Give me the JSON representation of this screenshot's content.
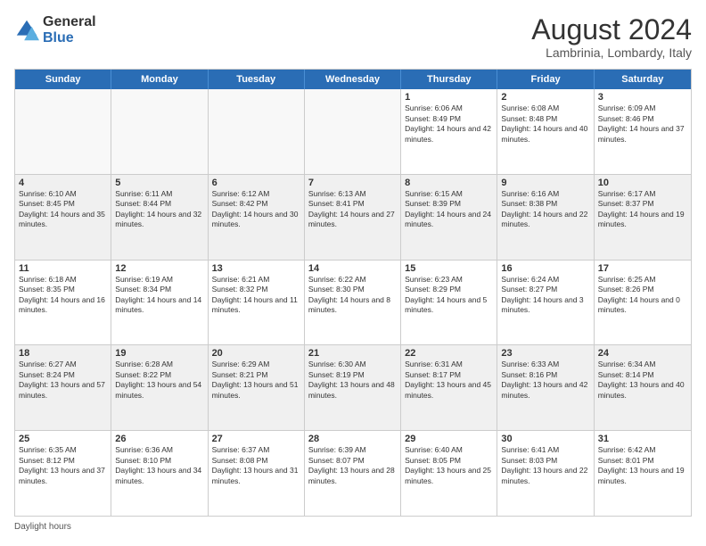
{
  "logo": {
    "general": "General",
    "blue": "Blue"
  },
  "title": "August 2024",
  "subtitle": "Lambrinia, Lombardy, Italy",
  "days": [
    "Sunday",
    "Monday",
    "Tuesday",
    "Wednesday",
    "Thursday",
    "Friday",
    "Saturday"
  ],
  "footer": "Daylight hours",
  "weeks": [
    [
      {
        "day": "",
        "text": ""
      },
      {
        "day": "",
        "text": ""
      },
      {
        "day": "",
        "text": ""
      },
      {
        "day": "",
        "text": ""
      },
      {
        "day": "1",
        "text": "Sunrise: 6:06 AM\nSunset: 8:49 PM\nDaylight: 14 hours and 42 minutes."
      },
      {
        "day": "2",
        "text": "Sunrise: 6:08 AM\nSunset: 8:48 PM\nDaylight: 14 hours and 40 minutes."
      },
      {
        "day": "3",
        "text": "Sunrise: 6:09 AM\nSunset: 8:46 PM\nDaylight: 14 hours and 37 minutes."
      }
    ],
    [
      {
        "day": "4",
        "text": "Sunrise: 6:10 AM\nSunset: 8:45 PM\nDaylight: 14 hours and 35 minutes."
      },
      {
        "day": "5",
        "text": "Sunrise: 6:11 AM\nSunset: 8:44 PM\nDaylight: 14 hours and 32 minutes."
      },
      {
        "day": "6",
        "text": "Sunrise: 6:12 AM\nSunset: 8:42 PM\nDaylight: 14 hours and 30 minutes."
      },
      {
        "day": "7",
        "text": "Sunrise: 6:13 AM\nSunset: 8:41 PM\nDaylight: 14 hours and 27 minutes."
      },
      {
        "day": "8",
        "text": "Sunrise: 6:15 AM\nSunset: 8:39 PM\nDaylight: 14 hours and 24 minutes."
      },
      {
        "day": "9",
        "text": "Sunrise: 6:16 AM\nSunset: 8:38 PM\nDaylight: 14 hours and 22 minutes."
      },
      {
        "day": "10",
        "text": "Sunrise: 6:17 AM\nSunset: 8:37 PM\nDaylight: 14 hours and 19 minutes."
      }
    ],
    [
      {
        "day": "11",
        "text": "Sunrise: 6:18 AM\nSunset: 8:35 PM\nDaylight: 14 hours and 16 minutes."
      },
      {
        "day": "12",
        "text": "Sunrise: 6:19 AM\nSunset: 8:34 PM\nDaylight: 14 hours and 14 minutes."
      },
      {
        "day": "13",
        "text": "Sunrise: 6:21 AM\nSunset: 8:32 PM\nDaylight: 14 hours and 11 minutes."
      },
      {
        "day": "14",
        "text": "Sunrise: 6:22 AM\nSunset: 8:30 PM\nDaylight: 14 hours and 8 minutes."
      },
      {
        "day": "15",
        "text": "Sunrise: 6:23 AM\nSunset: 8:29 PM\nDaylight: 14 hours and 5 minutes."
      },
      {
        "day": "16",
        "text": "Sunrise: 6:24 AM\nSunset: 8:27 PM\nDaylight: 14 hours and 3 minutes."
      },
      {
        "day": "17",
        "text": "Sunrise: 6:25 AM\nSunset: 8:26 PM\nDaylight: 14 hours and 0 minutes."
      }
    ],
    [
      {
        "day": "18",
        "text": "Sunrise: 6:27 AM\nSunset: 8:24 PM\nDaylight: 13 hours and 57 minutes."
      },
      {
        "day": "19",
        "text": "Sunrise: 6:28 AM\nSunset: 8:22 PM\nDaylight: 13 hours and 54 minutes."
      },
      {
        "day": "20",
        "text": "Sunrise: 6:29 AM\nSunset: 8:21 PM\nDaylight: 13 hours and 51 minutes."
      },
      {
        "day": "21",
        "text": "Sunrise: 6:30 AM\nSunset: 8:19 PM\nDaylight: 13 hours and 48 minutes."
      },
      {
        "day": "22",
        "text": "Sunrise: 6:31 AM\nSunset: 8:17 PM\nDaylight: 13 hours and 45 minutes."
      },
      {
        "day": "23",
        "text": "Sunrise: 6:33 AM\nSunset: 8:16 PM\nDaylight: 13 hours and 42 minutes."
      },
      {
        "day": "24",
        "text": "Sunrise: 6:34 AM\nSunset: 8:14 PM\nDaylight: 13 hours and 40 minutes."
      }
    ],
    [
      {
        "day": "25",
        "text": "Sunrise: 6:35 AM\nSunset: 8:12 PM\nDaylight: 13 hours and 37 minutes."
      },
      {
        "day": "26",
        "text": "Sunrise: 6:36 AM\nSunset: 8:10 PM\nDaylight: 13 hours and 34 minutes."
      },
      {
        "day": "27",
        "text": "Sunrise: 6:37 AM\nSunset: 8:08 PM\nDaylight: 13 hours and 31 minutes."
      },
      {
        "day": "28",
        "text": "Sunrise: 6:39 AM\nSunset: 8:07 PM\nDaylight: 13 hours and 28 minutes."
      },
      {
        "day": "29",
        "text": "Sunrise: 6:40 AM\nSunset: 8:05 PM\nDaylight: 13 hours and 25 minutes."
      },
      {
        "day": "30",
        "text": "Sunrise: 6:41 AM\nSunset: 8:03 PM\nDaylight: 13 hours and 22 minutes."
      },
      {
        "day": "31",
        "text": "Sunrise: 6:42 AM\nSunset: 8:01 PM\nDaylight: 13 hours and 19 minutes."
      }
    ]
  ]
}
